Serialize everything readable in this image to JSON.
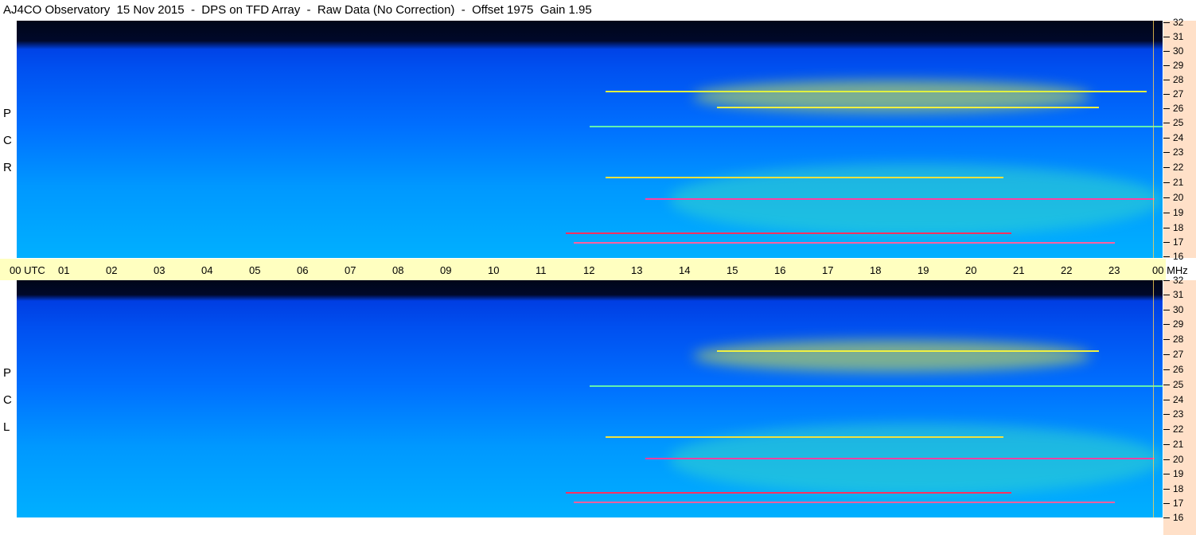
{
  "title": "AJ4CO Observatory  15 Nov 2015  -  DPS on TFD Array  -  Raw Data (No Correction)  -  Offset 1975  Gain 1.95",
  "panels": [
    {
      "id": "rcp",
      "letters": [
        "P",
        "C",
        "R"
      ]
    },
    {
      "id": "lcp",
      "letters": [
        "P",
        "C",
        "L"
      ]
    }
  ],
  "time_axis": {
    "labels": [
      "00 UTC",
      "01",
      "02",
      "03",
      "04",
      "05",
      "06",
      "07",
      "08",
      "09",
      "10",
      "11",
      "12",
      "13",
      "14",
      "15",
      "16",
      "17",
      "18",
      "19",
      "20",
      "21",
      "22",
      "23",
      "00 MHz"
    ]
  },
  "freq_scale": {
    "labels": [
      "32",
      "31",
      "30",
      "29",
      "28",
      "27",
      "26",
      "25",
      "24",
      "23",
      "22",
      "21",
      "20",
      "19",
      "18",
      "17",
      "16"
    ]
  },
  "colors": {
    "background": "#0030e0",
    "dark_band": "#000820",
    "timebar": "#ffffc0",
    "scale": "#ffe0c8",
    "activity_yellow": "#f0f040",
    "activity_red": "#ff3060",
    "activity_cyan": "#40e0c0"
  }
}
